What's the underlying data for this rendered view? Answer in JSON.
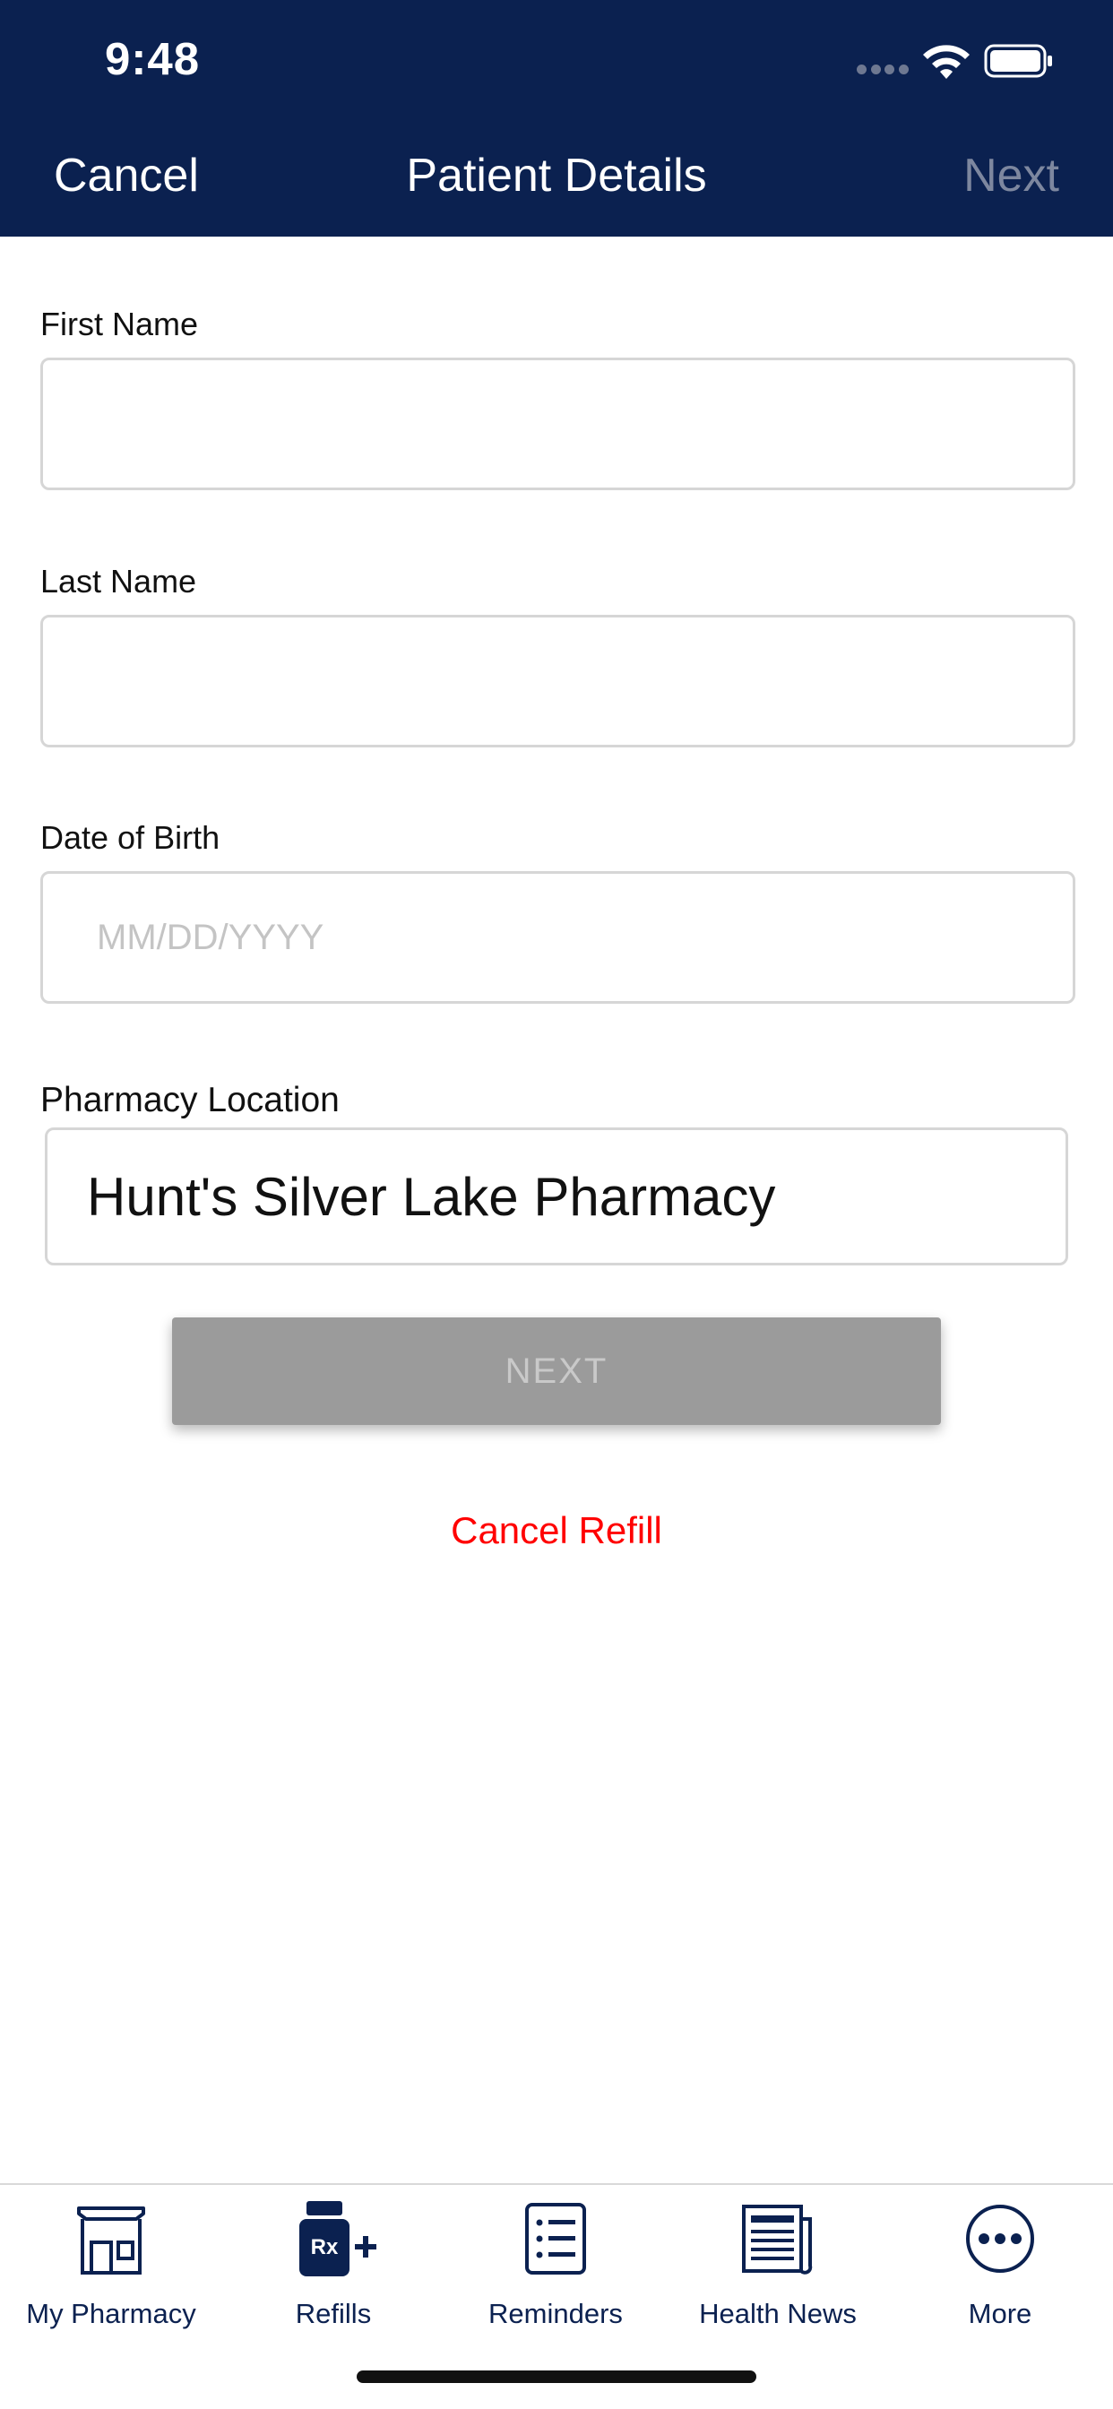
{
  "status_bar": {
    "time": "9:48"
  },
  "nav_bar": {
    "cancel_label": "Cancel",
    "title": "Patient Details",
    "next_label": "Next"
  },
  "form": {
    "first_name": {
      "label": "First Name",
      "value": ""
    },
    "last_name": {
      "label": "Last Name",
      "value": ""
    },
    "date_of_birth": {
      "label": "Date of Birth",
      "placeholder": "MM/DD/YYYY",
      "value": ""
    },
    "pharmacy_location": {
      "label": "Pharmacy Location",
      "value": "Hunt's Silver Lake Pharmacy"
    }
  },
  "actions": {
    "next_button_label": "NEXT",
    "cancel_refill_label": "Cancel Refill"
  },
  "tab_bar": {
    "tabs": [
      {
        "label": "My Pharmacy",
        "icon": "storefront-icon"
      },
      {
        "label": "Refills",
        "icon": "rx-refill-icon",
        "badge_text": "Rx"
      },
      {
        "label": "Reminders",
        "icon": "checklist-icon"
      },
      {
        "label": "Health News",
        "icon": "newspaper-icon"
      },
      {
        "label": "More",
        "icon": "more-dots-icon"
      }
    ]
  },
  "colors": {
    "header_background": "#0b2150",
    "accent_navy": "#0b2150",
    "disabled_button": "#9b9b9b",
    "cancel_refill": "#ff0000"
  }
}
